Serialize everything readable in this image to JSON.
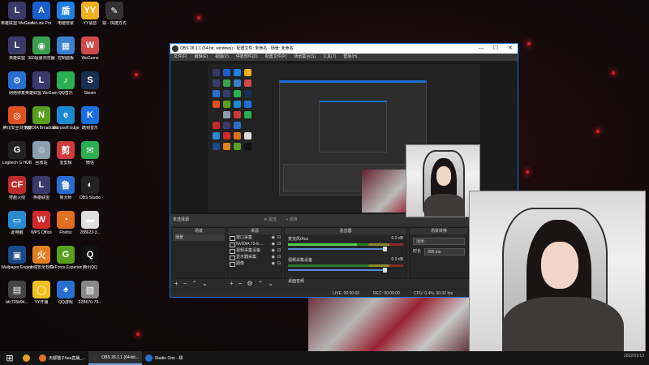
{
  "colors": {
    "obs_accent": "#1d6fd6",
    "tray_red": "#d0202a"
  },
  "desktop": {
    "icons": [
      {
        "label": "英雄联盟 WeGame版",
        "color": "#3a3a6a",
        "glyph": "L",
        "icon": "league-icon"
      },
      {
        "label": "AirLink Pro",
        "color": "#1a5fd0",
        "glyph": "A",
        "icon": "airlink-icon"
      },
      {
        "label": "电脑管家",
        "color": "#1e7fe0",
        "glyph": "盾",
        "icon": "shield-icon"
      },
      {
        "label": "YY语音",
        "color": "#f0b020",
        "glyph": "YY",
        "icon": "yy-icon"
      },
      {
        "label": "嫖 - 快捷方式",
        "color": "#333",
        "glyph": "✎",
        "icon": "shortcut-icon"
      },
      {
        "label": "英雄联盟",
        "color": "#3a3a6a",
        "glyph": "L",
        "icon": "league-icon"
      },
      {
        "label": "360极速浏览器",
        "color": "#3aa050",
        "glyph": "◉",
        "icon": "browser-icon"
      },
      {
        "label": "控制面板",
        "color": "#3a7fd0",
        "glyph": "▦",
        "icon": "control-panel-icon"
      },
      {
        "label": "WeGame",
        "color": "#d04a4a",
        "glyph": "W",
        "icon": "wegame-icon"
      },
      {
        "label": "网络修复",
        "color": "#2a6fd0",
        "glyph": "⚙",
        "icon": "network-icon"
      },
      {
        "label": "英雄联盟 WeGame版",
        "color": "#3a3a6a",
        "glyph": "L",
        "icon": "league-icon"
      },
      {
        "label": "QQ音乐",
        "color": "#2ab050",
        "glyph": "♪",
        "icon": "music-icon"
      },
      {
        "label": "Steam",
        "color": "#1a3050",
        "glyph": "S",
        "icon": "steam-icon"
      },
      {
        "label": "腾讯安全浏览器",
        "color": "#e05020",
        "glyph": "◎",
        "icon": "browser-icon"
      },
      {
        "label": "NVIDIA Broadcast",
        "color": "#5aa020",
        "glyph": "N",
        "icon": "nvidia-icon"
      },
      {
        "label": "Microsoft Edge",
        "color": "#1a8ad0",
        "glyph": "e",
        "icon": "edge-icon"
      },
      {
        "label": "酷狗音乐",
        "color": "#1a6fe0",
        "glyph": "K",
        "icon": "music-icon"
      },
      {
        "label": "Logitech G HUB",
        "color": "#222",
        "glyph": "G",
        "icon": "logitech-icon"
      },
      {
        "label": "回收站",
        "color": "#8aa0b0",
        "glyph": "♲",
        "icon": "recycle-bin-icon"
      },
      {
        "label": "爱剪辑",
        "color": "#d03a3a",
        "glyph": "剪",
        "icon": "editor-icon"
      },
      {
        "label": "微信",
        "color": "#2ab050",
        "glyph": "✉",
        "icon": "wechat-icon"
      },
      {
        "label": "穿越火线",
        "color": "#c02a2a",
        "glyph": "CF",
        "icon": "game-icon"
      },
      {
        "label": "英雄联盟",
        "color": "#3a3a6a",
        "glyph": "L",
        "icon": "league-icon"
      },
      {
        "label": "鲁大师",
        "color": "#2a6fd0",
        "glyph": "鲁",
        "icon": "utility-icon"
      },
      {
        "label": "OBS Studio",
        "color": "#222",
        "glyph": "◐",
        "icon": "obs-icon"
      },
      {
        "label": "此电脑",
        "color": "#2a8ad0",
        "glyph": "▭",
        "icon": "computer-icon"
      },
      {
        "label": "WPS Office",
        "color": "#d02a2a",
        "glyph": "W",
        "icon": "wps-icon"
      },
      {
        "label": "Firefox",
        "color": "#e07020",
        "glyph": "◔",
        "icon": "firefox-icon"
      },
      {
        "label": "288622-3...",
        "color": "#ddd",
        "glyph": "▬",
        "icon": "file-icon"
      },
      {
        "label": "Wallpaper Engine",
        "color": "#1a4a8a",
        "glyph": "▣",
        "icon": "wallpaper-icon"
      },
      {
        "label": "火绒安全软件",
        "color": "#e08020",
        "glyph": "火",
        "icon": "security-icon"
      },
      {
        "label": "GeForce Experience",
        "color": "#5aa020",
        "glyph": "G",
        "icon": "nvidia-icon"
      },
      {
        "label": "腾讯QQ",
        "color": "#111",
        "glyph": "Q",
        "icon": "qq-icon"
      },
      {
        "label": "bfc705b94...",
        "color": "#444",
        "glyph": "▤",
        "icon": "file-icon"
      },
      {
        "label": "YY开播",
        "color": "#f0c020",
        "glyph": "◯",
        "icon": "yy-icon"
      },
      {
        "label": "QQ游戏",
        "color": "#2a6fd0",
        "glyph": "♠",
        "icon": "game-icon"
      },
      {
        "label": "22B670-79...",
        "color": "#888",
        "glyph": "▧",
        "icon": "image-file-icon"
      }
    ]
  },
  "obs": {
    "title": "OBS 26.1.1 (64-bit, windows) - 配置文件: 未命名 - 场景: 未命名",
    "window_buttons": [
      "—",
      "☐",
      "✕"
    ],
    "menu": [
      "文件(F)",
      "编辑(E)",
      "视图(V)",
      "停靠部件(D)",
      "配置文件(P)",
      "场景集合(S)",
      "工具(T)",
      "帮助(H)"
    ],
    "control_strip": {
      "label": "未选择源",
      "btn_props": "属性",
      "btn_filters": "滤镜"
    },
    "scenes": {
      "header": "场景",
      "items": [
        "场景"
      ]
    },
    "sources": {
      "header": "来源",
      "items": [
        "窗口采集",
        "NVIDIA 75-8.....",
        "视频采集设备",
        "显示器采集",
        "图像"
      ]
    },
    "mixer": {
      "header": "混音器",
      "channels": [
        {
          "name": "麦克风/Aux",
          "db": "0.0 dB"
        },
        {
          "name": "视频采集设备",
          "db": "0.0 dB"
        },
        {
          "name": "桌面音频",
          "db": ""
        }
      ]
    },
    "transitions": {
      "header": "场景转换",
      "type": "淡出",
      "duration_label": "时长",
      "duration": "300 ms"
    },
    "status": {
      "live": "LIVE: 00:00:00",
      "rec": "REC: 00:00:00",
      "cpu": "CPU: 0.4%, 60.00 fps"
    }
  },
  "taskbar": {
    "start": "⊞",
    "tasks": [
      {
        "label": "",
        "color": "#e0a020"
      },
      {
        "label": "天都猫子hea直播_...",
        "color": "#e07020"
      },
      {
        "label": "OBS 26.1.1 (64-bit...",
        "color": "#333"
      },
      {
        "label": "Studio One - 嫖",
        "color": "#2a6fd0"
      }
    ],
    "clock": "2022/01/13"
  }
}
